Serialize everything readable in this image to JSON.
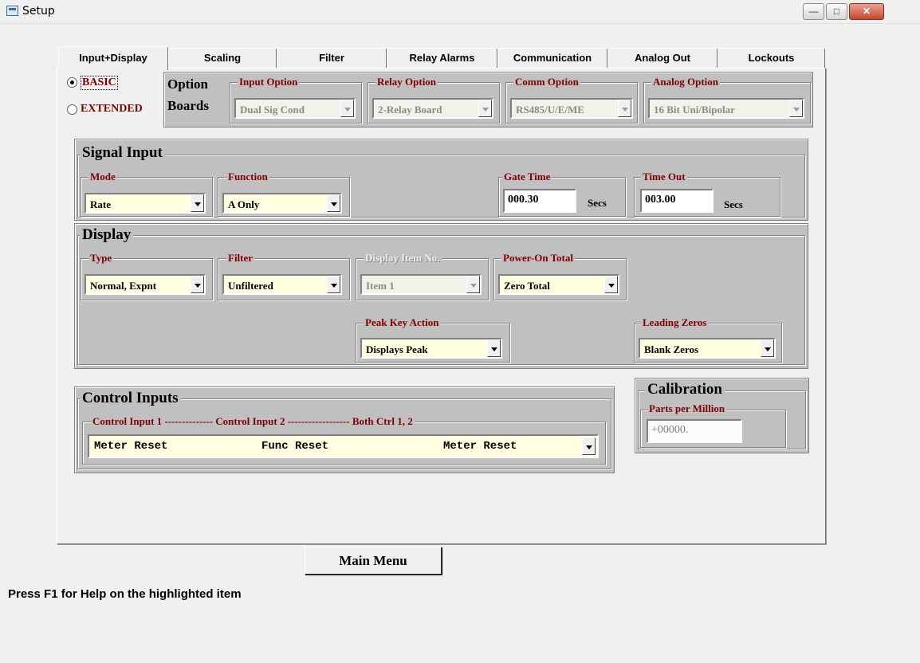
{
  "window": {
    "title": "Setup"
  },
  "tabs": [
    "Input+Display",
    "Scaling",
    "Filter",
    "Relay Alarms",
    "Communication",
    "Analog Out",
    "Lockouts"
  ],
  "mode": {
    "basic": "BASIC",
    "extended": "EXTENDED",
    "selected": "BASIC"
  },
  "option_boards": {
    "label_line1": "Option",
    "label_line2": "Boards",
    "input": {
      "label": "Input Option",
      "value": "Dual Sig Cond"
    },
    "relay": {
      "label": "Relay Option",
      "value": "2-Relay Board"
    },
    "comm": {
      "label": "Comm Option",
      "value": "RS485/U/E/ME"
    },
    "analog": {
      "label": "Analog Option",
      "value": "16 Bit Uni/Bipolar"
    }
  },
  "signal_input": {
    "title": "Signal Input",
    "mode": {
      "label": "Mode",
      "value": "Rate"
    },
    "function": {
      "label": "Function",
      "value": "A Only"
    },
    "gate_time": {
      "label": "Gate Time",
      "value": "000.30",
      "unit": "Secs"
    },
    "time_out": {
      "label": "Time Out",
      "value": "003.00",
      "unit": "Secs"
    }
  },
  "display": {
    "title": "Display",
    "type": {
      "label": "Type",
      "value": "Normal, Expnt"
    },
    "filter": {
      "label": "Filter",
      "value": "Unfiltered"
    },
    "item_no": {
      "label": "Display Item No.",
      "value": "Item 1"
    },
    "power_on_total": {
      "label": "Power-On Total",
      "value": "Zero Total"
    },
    "peak_key": {
      "label": "Peak Key Action",
      "value": "Displays Peak"
    },
    "leading_zeros": {
      "label": "Leading Zeros",
      "value": "Blank Zeros"
    }
  },
  "control_inputs": {
    "title": "Control Inputs",
    "header": "Control Input 1 -------------- Control Input 2 ------------------ Both Ctrl 1, 2",
    "ctrl1": "Meter Reset",
    "ctrl2": "Func Reset",
    "both": "Meter Reset"
  },
  "calibration": {
    "title": "Calibration",
    "label": "Parts per Million",
    "value": "+00000."
  },
  "main_menu": "Main Menu",
  "status": "Press F1 for Help on the highlighted item"
}
